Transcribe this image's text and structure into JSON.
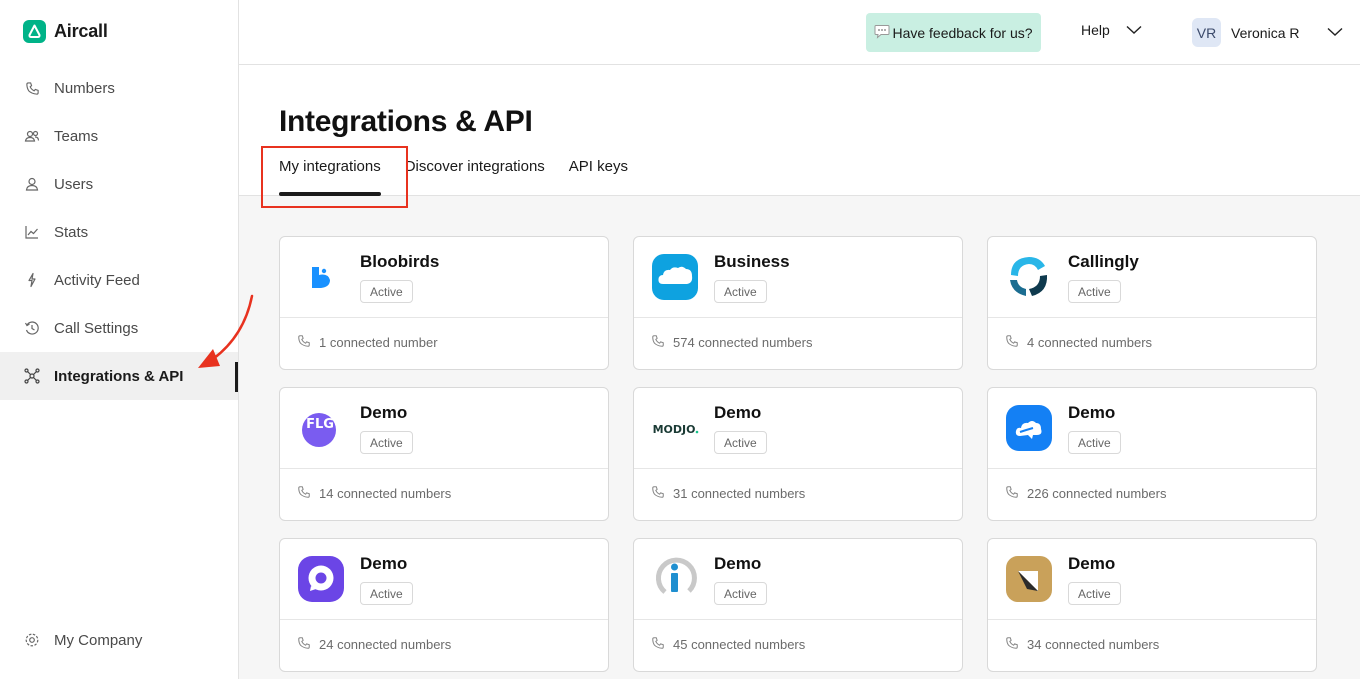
{
  "app": {
    "name": "Aircall"
  },
  "sidebar": {
    "items": [
      {
        "label": "Numbers",
        "icon": "phone-icon"
      },
      {
        "label": "Teams",
        "icon": "team-icon"
      },
      {
        "label": "Users",
        "icon": "user-icon"
      },
      {
        "label": "Stats",
        "icon": "chart-icon"
      },
      {
        "label": "Activity Feed",
        "icon": "activity-icon"
      },
      {
        "label": "Call Settings",
        "icon": "call-settings-icon"
      },
      {
        "label": "Integrations & API",
        "icon": "integrations-icon",
        "active": true
      }
    ],
    "bottom": {
      "label": "My Company",
      "icon": "company-icon"
    }
  },
  "topbar": {
    "feedback_label": "Have feedback for us?",
    "help_label": "Help",
    "user": {
      "initials": "VR",
      "name": "Veronica R"
    }
  },
  "page": {
    "title": "Integrations & API",
    "tabs": [
      {
        "label": "My integrations",
        "active": true
      },
      {
        "label": "Discover integrations"
      },
      {
        "label": "API keys"
      }
    ]
  },
  "integrations": [
    {
      "name": "Bloobirds",
      "status": "Active",
      "numbers": "1 connected number",
      "logo": "bloobirds-logo"
    },
    {
      "name": "Business",
      "status": "Active",
      "numbers": "574 connected numbers",
      "logo": "salesforce-cloud-logo"
    },
    {
      "name": "Callingly",
      "status": "Active",
      "numbers": "4 connected numbers",
      "logo": "callingly-logo"
    },
    {
      "name": "Demo",
      "status": "Active",
      "numbers": "14 connected numbers",
      "logo": "flg-logo",
      "logo_text": "FLG"
    },
    {
      "name": "Demo",
      "status": "Active",
      "numbers": "31 connected numbers",
      "logo": "modjo-logo",
      "logo_text": "MODJO"
    },
    {
      "name": "Demo",
      "status": "Active",
      "numbers": "226 connected numbers",
      "logo": "blue-cloud-logo"
    },
    {
      "name": "Demo",
      "status": "Active",
      "numbers": "24 connected numbers",
      "logo": "purple-ring-logo"
    },
    {
      "name": "Demo",
      "status": "Active",
      "numbers": "45 connected numbers",
      "logo": "info-i-logo"
    },
    {
      "name": "Demo",
      "status": "Active",
      "numbers": "34 connected numbers",
      "logo": "gold-square-logo"
    }
  ],
  "colors": {
    "brand": "#00b388",
    "feedback_bg": "#c9efe2",
    "annotation": "#e8321f"
  }
}
